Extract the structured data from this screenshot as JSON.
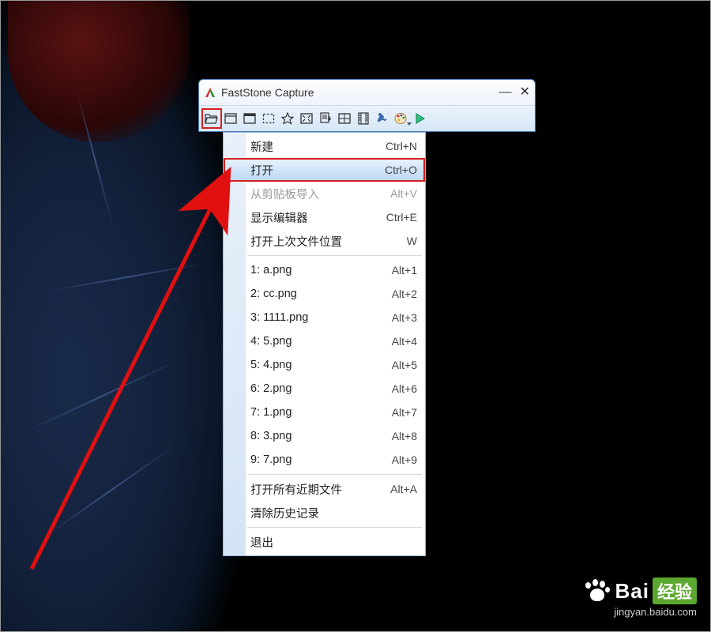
{
  "window": {
    "title": "FastStone Capture"
  },
  "toolbar": {
    "buttons": [
      {
        "name": "open-menu-button",
        "icon": "folder-open-icon"
      },
      {
        "name": "capture-active-window-button",
        "icon": "window-icon"
      },
      {
        "name": "capture-window-object-button",
        "icon": "window-filled-icon"
      },
      {
        "name": "capture-rectangle-button",
        "icon": "rect-dashed-icon"
      },
      {
        "name": "capture-freehand-button",
        "icon": "freehand-icon"
      },
      {
        "name": "capture-fullscreen-button",
        "icon": "fullscreen-icon"
      },
      {
        "name": "capture-scrolling-button",
        "icon": "scroll-icon"
      },
      {
        "name": "capture-fixed-region-button",
        "icon": "fixed-region-icon"
      },
      {
        "name": "screen-recorder-button",
        "icon": "film-icon"
      },
      {
        "name": "delay-button",
        "icon": "pin-icon"
      },
      {
        "name": "output-options-button",
        "icon": "palette-icon",
        "dropdown": true
      },
      {
        "name": "settings-button",
        "icon": "settings-arrow-icon"
      }
    ]
  },
  "menu": {
    "groups": [
      [
        {
          "label": "新建",
          "shortcut": "Ctrl+N",
          "name": "menu-new"
        },
        {
          "label": "打开",
          "shortcut": "Ctrl+O",
          "name": "menu-open",
          "highlight": true
        },
        {
          "label": "从剪贴板导入",
          "shortcut": "Alt+V",
          "name": "menu-import-clipboard",
          "disabled": true
        },
        {
          "label": "显示编辑器",
          "shortcut": "Ctrl+E",
          "name": "menu-show-editor"
        },
        {
          "label": "打开上次文件位置",
          "shortcut": "W",
          "name": "menu-open-last-location"
        }
      ],
      [
        {
          "label": "1:  a.png",
          "shortcut": "Alt+1",
          "name": "menu-recent-1"
        },
        {
          "label": "2:  cc.png",
          "shortcut": "Alt+2",
          "name": "menu-recent-2"
        },
        {
          "label": "3:  1111.png",
          "shortcut": "Alt+3",
          "name": "menu-recent-3"
        },
        {
          "label": "4:  5.png",
          "shortcut": "Alt+4",
          "name": "menu-recent-4"
        },
        {
          "label": "5:  4.png",
          "shortcut": "Alt+5",
          "name": "menu-recent-5"
        },
        {
          "label": "6:  2.png",
          "shortcut": "Alt+6",
          "name": "menu-recent-6"
        },
        {
          "label": "7:  1.png",
          "shortcut": "Alt+7",
          "name": "menu-recent-7"
        },
        {
          "label": "8:  3.png",
          "shortcut": "Alt+8",
          "name": "menu-recent-8"
        },
        {
          "label": "9:  7.png",
          "shortcut": "Alt+9",
          "name": "menu-recent-9"
        }
      ],
      [
        {
          "label": "打开所有近期文件",
          "shortcut": "Alt+A",
          "name": "menu-open-all-recent"
        },
        {
          "label": "清除历史记录",
          "shortcut": "",
          "name": "menu-clear-history"
        }
      ],
      [
        {
          "label": "退出",
          "shortcut": "",
          "name": "menu-exit"
        }
      ]
    ]
  },
  "watermark": {
    "brand_a": "Bai",
    "brand_b": "经验",
    "sub": "jingyan.baidu.com"
  }
}
